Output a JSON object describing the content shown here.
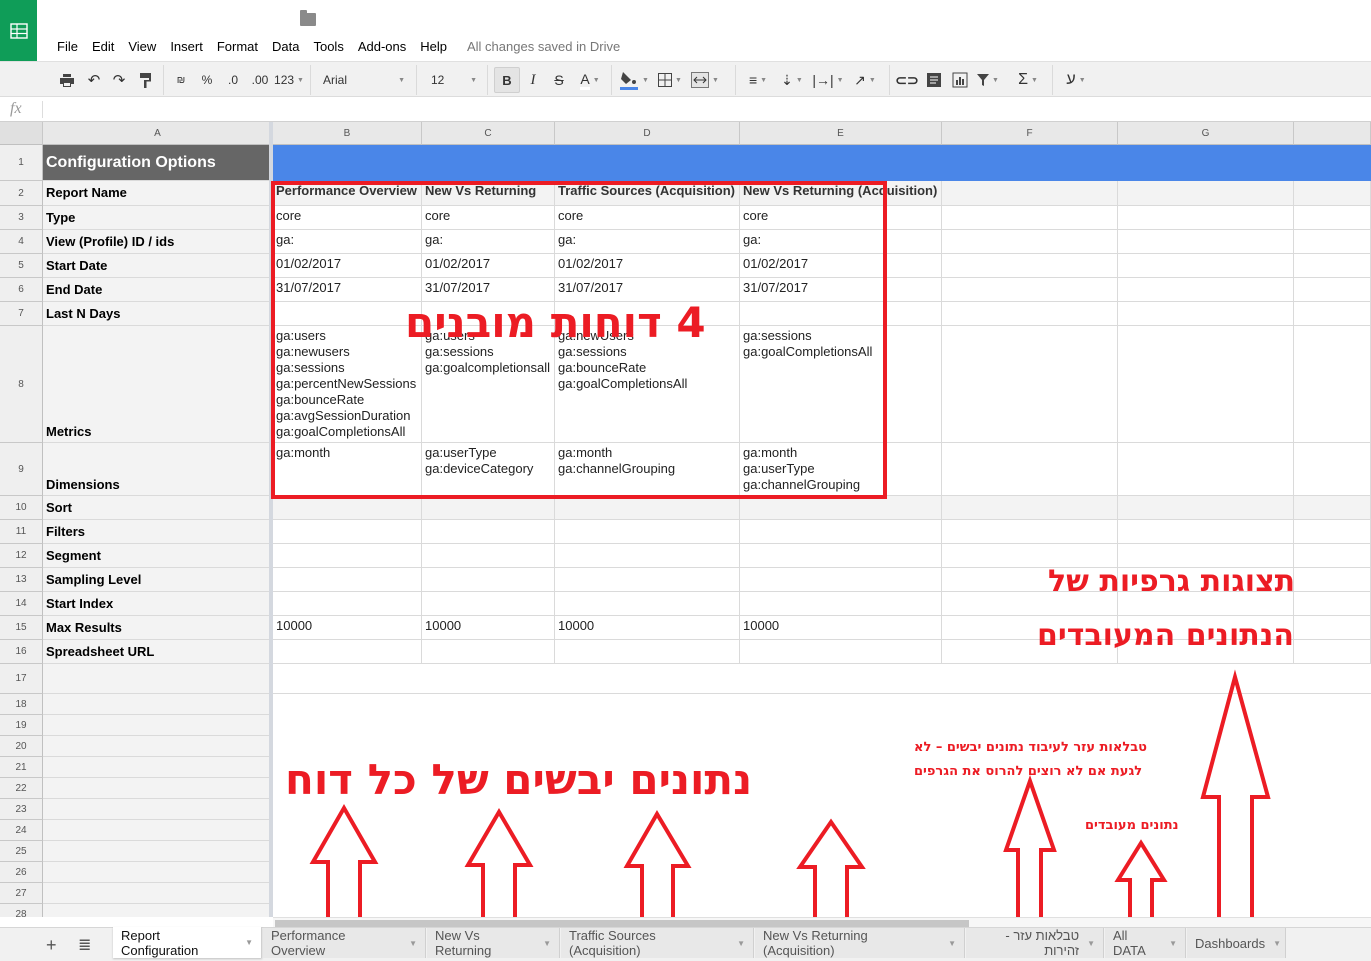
{
  "app": {
    "menu": [
      "File",
      "Edit",
      "View",
      "Insert",
      "Format",
      "Data",
      "Tools",
      "Add-ons",
      "Help"
    ],
    "save_status": "All changes saved in Drive"
  },
  "toolbar": {
    "currency": "₪",
    "percent": "%",
    "decrease_decimal": ".0",
    "increase_decimal": ".00",
    "number_format": "123",
    "font": "Arial",
    "font_size": "12",
    "bold": "B",
    "italic": "I",
    "strike": "S",
    "text_color": "A",
    "sum": "Σ",
    "input_tools": "ע",
    "fill_color": "#4a86e8"
  },
  "formula_bar": {
    "fx": "fx",
    "value": ""
  },
  "columns": [
    "A",
    "B",
    "C",
    "D",
    "E",
    "F",
    "G"
  ],
  "rows": [
    {
      "n": "1",
      "label": "Configuration Options",
      "values": [
        "",
        "",
        "",
        ""
      ]
    },
    {
      "n": "2",
      "label": "Report Name",
      "values": [
        "Performance Overview",
        "New Vs Returning",
        "Traffic Sources (Acquisition)",
        "New Vs Returning (Acquisition)"
      ]
    },
    {
      "n": "3",
      "label": "Type",
      "values": [
        "core",
        "core",
        "core",
        "core"
      ]
    },
    {
      "n": "4",
      "label": "View (Profile) ID / ids",
      "values": [
        "ga:",
        "ga:",
        "ga:",
        "ga:"
      ]
    },
    {
      "n": "5",
      "label": "Start Date",
      "values": [
        "01/02/2017",
        "01/02/2017",
        "01/02/2017",
        "01/02/2017"
      ]
    },
    {
      "n": "6",
      "label": "End Date",
      "values": [
        "31/07/2017",
        "31/07/2017",
        "31/07/2017",
        "31/07/2017"
      ]
    },
    {
      "n": "7",
      "label": "Last N Days",
      "values": [
        "",
        "",
        "",
        ""
      ]
    },
    {
      "n": "8",
      "label": "Metrics",
      "values": [
        "ga:users\nga:newusers\nga:sessions\nga:percentNewSessions\nga:bounceRate\nga:avgSessionDuration\nga:goalCompletionsAll",
        "ga:users\nga:sessions\nga:goalcompletionsall",
        "ga:newUsers\nga:sessions\nga:bounceRate\nga:goalCompletionsAll",
        "ga:sessions\nga:goalCompletionsAll"
      ]
    },
    {
      "n": "9",
      "label": "Dimensions",
      "values": [
        "ga:month",
        "ga:userType\nga:deviceCategory",
        "ga:month\nga:channelGrouping",
        "ga:month\nga:userType\nga:channelGrouping"
      ]
    },
    {
      "n": "10",
      "label": "Sort",
      "values": [
        "",
        "",
        "",
        ""
      ]
    },
    {
      "n": "11",
      "label": "Filters",
      "values": [
        "",
        "",
        "",
        ""
      ]
    },
    {
      "n": "12",
      "label": "Segment",
      "values": [
        "",
        "",
        "",
        ""
      ]
    },
    {
      "n": "13",
      "label": "Sampling Level",
      "values": [
        "",
        "",
        "",
        ""
      ]
    },
    {
      "n": "14",
      "label": "Start Index",
      "values": [
        "",
        "",
        "",
        ""
      ]
    },
    {
      "n": "15",
      "label": "Max Results",
      "values": [
        "10000",
        "10000",
        "10000",
        "10000"
      ]
    },
    {
      "n": "16",
      "label": "Spreadsheet URL",
      "values": [
        "",
        "",
        "",
        ""
      ]
    },
    {
      "n": "17",
      "label": "",
      "values": []
    },
    {
      "n": "18",
      "label": "",
      "values": []
    },
    {
      "n": "19",
      "label": "",
      "values": []
    },
    {
      "n": "20",
      "label": "",
      "values": []
    },
    {
      "n": "21",
      "label": "",
      "values": []
    },
    {
      "n": "22",
      "label": "",
      "values": []
    },
    {
      "n": "23",
      "label": "",
      "values": []
    },
    {
      "n": "24",
      "label": "",
      "values": []
    },
    {
      "n": "25",
      "label": "",
      "values": []
    },
    {
      "n": "26",
      "label": "",
      "values": []
    },
    {
      "n": "27",
      "label": "",
      "values": []
    },
    {
      "n": "28",
      "label": "",
      "values": []
    }
  ],
  "annotations": {
    "four_reports": "4 דוחות מובנים",
    "raw_data": "נתונים יבשים של כל דוח",
    "helper_tables_line1": "טבלאות עזר לעיבוד נתונים יבשים – לא",
    "helper_tables_line2": "לגעת אם לא רוצים להרוס את הגרפים",
    "processed_data": "נתונים מעובדים",
    "dashboards_line1": "תצוגות גרפיות של",
    "dashboards_line2": "הנתונים המעובדים",
    "color": "#ec1c24"
  },
  "sheet_tabs": [
    {
      "label": "Report Configuration",
      "active": true
    },
    {
      "label": "Performance Overview",
      "active": false
    },
    {
      "label": "New Vs Returning",
      "active": false
    },
    {
      "label": "Traffic Sources (Acquisition)",
      "active": false
    },
    {
      "label": "New Vs Returning (Acquisition)",
      "active": false
    },
    {
      "label": "טבלאות עזר - זהירות",
      "active": false
    },
    {
      "label": "All DATA",
      "active": false
    },
    {
      "label": "Dashboards",
      "active": false
    }
  ]
}
